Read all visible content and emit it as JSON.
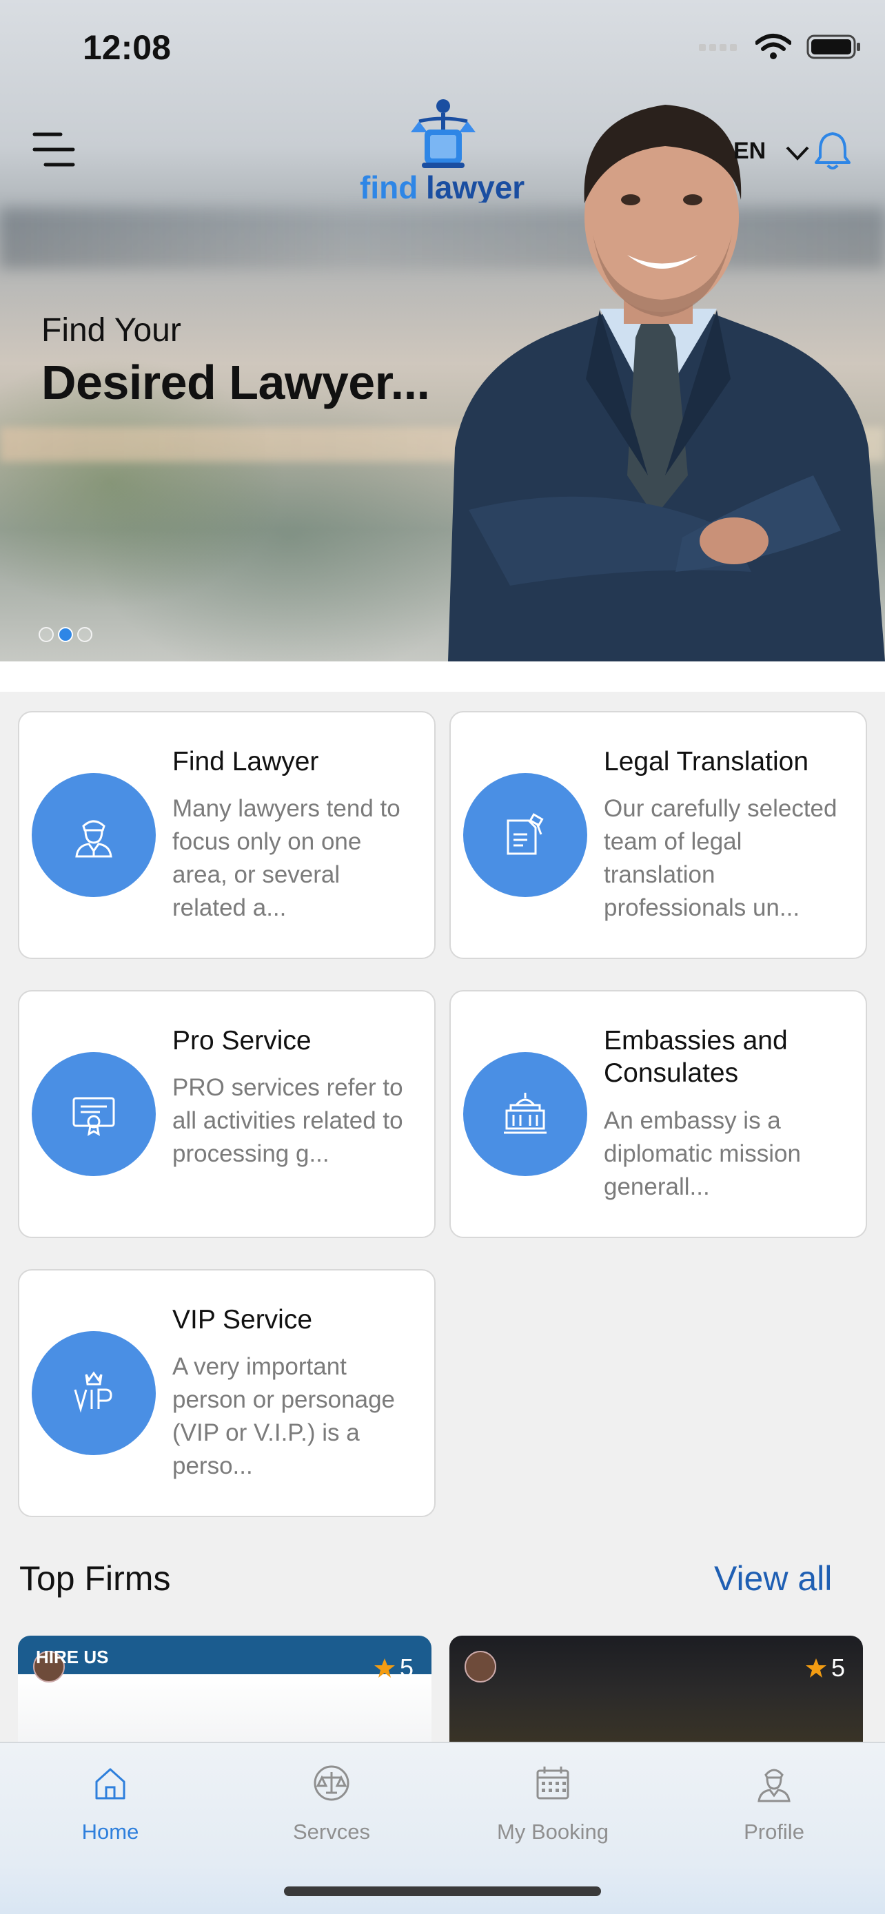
{
  "status_bar": {
    "time": "12:08"
  },
  "header": {
    "logo_text_find": "find",
    "logo_text_lawyer": "lawyer",
    "language": "EN"
  },
  "hero": {
    "subtitle": "Find Your",
    "title": "Desired Lawyer...",
    "slides": 3,
    "active_slide": 2
  },
  "services": [
    {
      "title": "Find Lawyer",
      "description": "Many lawyers tend to focus only on one area, or several related a...",
      "icon": "lawyer-icon"
    },
    {
      "title": "Legal Translation",
      "description": "Our carefully selected team of legal translation professionals un...",
      "icon": "document-gavel-icon"
    },
    {
      "title": "Pro Service",
      "description": "PRO services refer to all activities related to processing g...",
      "icon": "certificate-icon"
    },
    {
      "title": "Embassies and Consulates",
      "description": "An embassy is a diplomatic mission generall...",
      "icon": "embassy-building-icon"
    },
    {
      "title": "VIP Service",
      "description": "A very important person or personage (VIP or V.I.P.) is a perso...",
      "icon": "vip-crown-icon"
    }
  ],
  "top_firms": {
    "title": "Top Firms",
    "view_all": "View all",
    "firms": [
      {
        "badge": "HIRE US",
        "rating": "5"
      },
      {
        "badge": "",
        "rating": "5"
      }
    ]
  },
  "tabbar": {
    "tabs": [
      {
        "label": "Home",
        "icon": "home-icon",
        "active": true
      },
      {
        "label": "Servces",
        "icon": "scales-icon",
        "active": false
      },
      {
        "label": "My Booking",
        "icon": "calendar-icon",
        "active": false
      },
      {
        "label": "Profile",
        "icon": "profile-icon",
        "active": false
      }
    ]
  },
  "colors": {
    "accent": "#4a8fe4",
    "link": "#1f5fb3",
    "tab_active": "#2e7fdc",
    "star": "#f39c12"
  }
}
